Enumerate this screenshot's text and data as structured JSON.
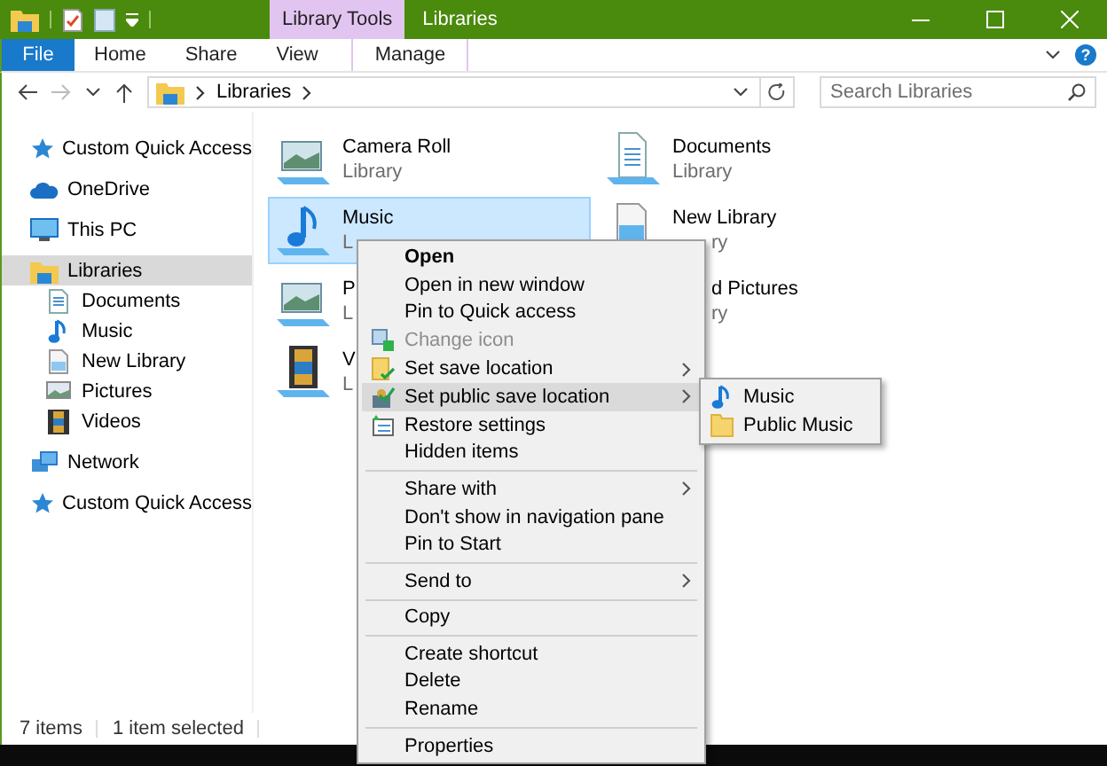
{
  "title_bar": {
    "contextual_tab": "Library Tools",
    "title": "Libraries"
  },
  "ribbon": {
    "tabs": [
      {
        "label": "File",
        "kind": "file",
        "selected": false
      },
      {
        "label": "Home",
        "kind": "tab",
        "selected": false
      },
      {
        "label": "Share",
        "kind": "tab",
        "selected": false
      },
      {
        "label": "View",
        "kind": "tab",
        "selected": false
      },
      {
        "label": "Manage",
        "kind": "contextual",
        "selected": false
      }
    ],
    "help": "?"
  },
  "address_bar": {
    "path": "Libraries",
    "search_placeholder": "Search Libraries"
  },
  "nav": {
    "items": [
      {
        "label": "Custom Quick Access",
        "selected": false
      },
      {
        "label": "OneDrive",
        "selected": false
      },
      {
        "label": "This PC",
        "selected": false
      },
      {
        "label": "Libraries",
        "selected": true,
        "children": [
          {
            "label": "Documents",
            "selected": false
          },
          {
            "label": "Music",
            "selected": false
          },
          {
            "label": "New Library",
            "selected": false
          },
          {
            "label": "Pictures",
            "selected": false
          },
          {
            "label": "Videos",
            "selected": false
          }
        ]
      },
      {
        "label": "Network",
        "selected": false
      },
      {
        "label": "Custom Quick Access",
        "selected": false
      }
    ]
  },
  "libraries": [
    {
      "name": "Camera Roll",
      "subtitle": "Library",
      "kind": "library",
      "selected": false
    },
    {
      "name": "Documents",
      "subtitle": "Library",
      "kind": "library",
      "selected": false
    },
    {
      "name": "Music",
      "subtitle": "L",
      "kind": "library",
      "selected": true
    },
    {
      "name": "New Library",
      "subtitle": "ry",
      "kind": "subtitle-covered",
      "selected": false
    },
    {
      "name": "P",
      "subtitle": "L",
      "kind": "library",
      "selected": false
    },
    {
      "name": "d Pictures",
      "subtitle": "ry",
      "kind": "covered",
      "selected": false
    },
    {
      "name": "V",
      "subtitle": "L",
      "kind": "library",
      "selected": false
    }
  ],
  "context_menu": {
    "items": [
      {
        "kind": "item",
        "label": "Open",
        "default": true,
        "disabled": false,
        "submenu": false,
        "selected": false
      },
      {
        "kind": "item",
        "label": "Open in new window",
        "default": false,
        "disabled": false,
        "submenu": false,
        "selected": false
      },
      {
        "kind": "item",
        "label": "Pin to Quick access",
        "default": false,
        "disabled": false,
        "submenu": false,
        "selected": false
      },
      {
        "kind": "item",
        "label": "Change icon",
        "default": false,
        "disabled": true,
        "submenu": false,
        "selected": false
      },
      {
        "kind": "item",
        "label": "Set save location",
        "default": false,
        "disabled": false,
        "submenu": true,
        "selected": false
      },
      {
        "kind": "item",
        "label": "Set public save location",
        "default": false,
        "disabled": false,
        "submenu": true,
        "selected": true
      },
      {
        "kind": "item",
        "label": "Restore settings",
        "default": false,
        "disabled": false,
        "submenu": false,
        "selected": false
      },
      {
        "kind": "item",
        "label": "Hidden items",
        "default": false,
        "disabled": false,
        "submenu": false,
        "selected": false
      },
      {
        "kind": "separator"
      },
      {
        "kind": "item",
        "label": "Share with",
        "default": false,
        "disabled": false,
        "submenu": true,
        "selected": false
      },
      {
        "kind": "item",
        "label": "Don't show in navigation pane",
        "default": false,
        "disabled": false,
        "submenu": false,
        "selected": false
      },
      {
        "kind": "item",
        "label": "Pin to Start",
        "default": false,
        "disabled": false,
        "submenu": false,
        "selected": false
      },
      {
        "kind": "separator"
      },
      {
        "kind": "item",
        "label": "Send to",
        "default": false,
        "disabled": false,
        "submenu": true,
        "selected": false
      },
      {
        "kind": "separator"
      },
      {
        "kind": "item",
        "label": "Copy",
        "default": false,
        "disabled": false,
        "submenu": false,
        "selected": false
      },
      {
        "kind": "separator"
      },
      {
        "kind": "item",
        "label": "Create shortcut",
        "default": false,
        "disabled": false,
        "submenu": false,
        "selected": false
      },
      {
        "kind": "item",
        "label": "Delete",
        "default": false,
        "disabled": false,
        "submenu": false,
        "selected": false
      },
      {
        "kind": "item",
        "label": "Rename",
        "default": false,
        "disabled": false,
        "submenu": false,
        "selected": false
      },
      {
        "kind": "separator"
      },
      {
        "kind": "item",
        "label": "Properties",
        "default": false,
        "disabled": false,
        "submenu": false,
        "selected": false
      }
    ]
  },
  "submenu": {
    "items": [
      {
        "label": "Music"
      },
      {
        "label": "Public Music"
      }
    ]
  },
  "status_bar": {
    "item_count": "7 items",
    "selection": "1 item selected"
  }
}
